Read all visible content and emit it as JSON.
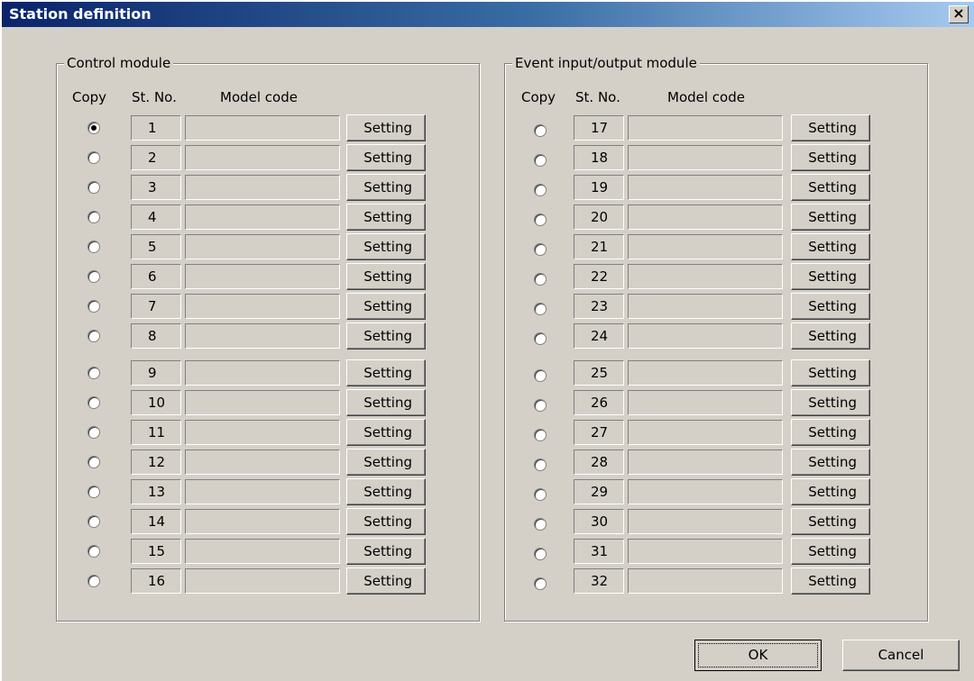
{
  "window": {
    "title": "Station definition",
    "close_glyph": "×"
  },
  "control_group": {
    "legend": "Control module",
    "headers": {
      "copy": "Copy",
      "st_no": "St. No.",
      "model_code": "Model code"
    },
    "rows": [
      {
        "st": "1",
        "model": "",
        "button": "Setting",
        "selected": true
      },
      {
        "st": "2",
        "model": "",
        "button": "Setting",
        "selected": false
      },
      {
        "st": "3",
        "model": "",
        "button": "Setting",
        "selected": false
      },
      {
        "st": "4",
        "model": "",
        "button": "Setting",
        "selected": false
      },
      {
        "st": "5",
        "model": "",
        "button": "Setting",
        "selected": false
      },
      {
        "st": "6",
        "model": "",
        "button": "Setting",
        "selected": false
      },
      {
        "st": "7",
        "model": "",
        "button": "Setting",
        "selected": false
      },
      {
        "st": "8",
        "model": "",
        "button": "Setting",
        "selected": false
      },
      {
        "st": "9",
        "model": "",
        "button": "Setting",
        "selected": false
      },
      {
        "st": "10",
        "model": "",
        "button": "Setting",
        "selected": false
      },
      {
        "st": "11",
        "model": "",
        "button": "Setting",
        "selected": false
      },
      {
        "st": "12",
        "model": "",
        "button": "Setting",
        "selected": false
      },
      {
        "st": "13",
        "model": "",
        "button": "Setting",
        "selected": false
      },
      {
        "st": "14",
        "model": "",
        "button": "Setting",
        "selected": false
      },
      {
        "st": "15",
        "model": "",
        "button": "Setting",
        "selected": false
      },
      {
        "st": "16",
        "model": "",
        "button": "Setting",
        "selected": false
      }
    ]
  },
  "event_group": {
    "legend": "Event input/output module",
    "headers": {
      "copy": "Copy",
      "st_no": "St. No.",
      "model_code": "Model code"
    },
    "rows": [
      {
        "st": "17",
        "model": "",
        "button": "Setting",
        "selected": false
      },
      {
        "st": "18",
        "model": "",
        "button": "Setting",
        "selected": false
      },
      {
        "st": "19",
        "model": "",
        "button": "Setting",
        "selected": false
      },
      {
        "st": "20",
        "model": "",
        "button": "Setting",
        "selected": false
      },
      {
        "st": "21",
        "model": "",
        "button": "Setting",
        "selected": false
      },
      {
        "st": "22",
        "model": "",
        "button": "Setting",
        "selected": false
      },
      {
        "st": "23",
        "model": "",
        "button": "Setting",
        "selected": false
      },
      {
        "st": "24",
        "model": "",
        "button": "Setting",
        "selected": false
      },
      {
        "st": "25",
        "model": "",
        "button": "Setting",
        "selected": false
      },
      {
        "st": "26",
        "model": "",
        "button": "Setting",
        "selected": false
      },
      {
        "st": "27",
        "model": "",
        "button": "Setting",
        "selected": false
      },
      {
        "st": "28",
        "model": "",
        "button": "Setting",
        "selected": false
      },
      {
        "st": "29",
        "model": "",
        "button": "Setting",
        "selected": false
      },
      {
        "st": "30",
        "model": "",
        "button": "Setting",
        "selected": false
      },
      {
        "st": "31",
        "model": "",
        "button": "Setting",
        "selected": false
      },
      {
        "st": "32",
        "model": "",
        "button": "Setting",
        "selected": false
      }
    ]
  },
  "footer": {
    "ok_label": "OK",
    "cancel_label": "Cancel"
  },
  "colors": {
    "dialog_bg": "#d4d0c8",
    "title_gradient_start": "#0a246a",
    "title_gradient_end": "#a6caf0"
  }
}
